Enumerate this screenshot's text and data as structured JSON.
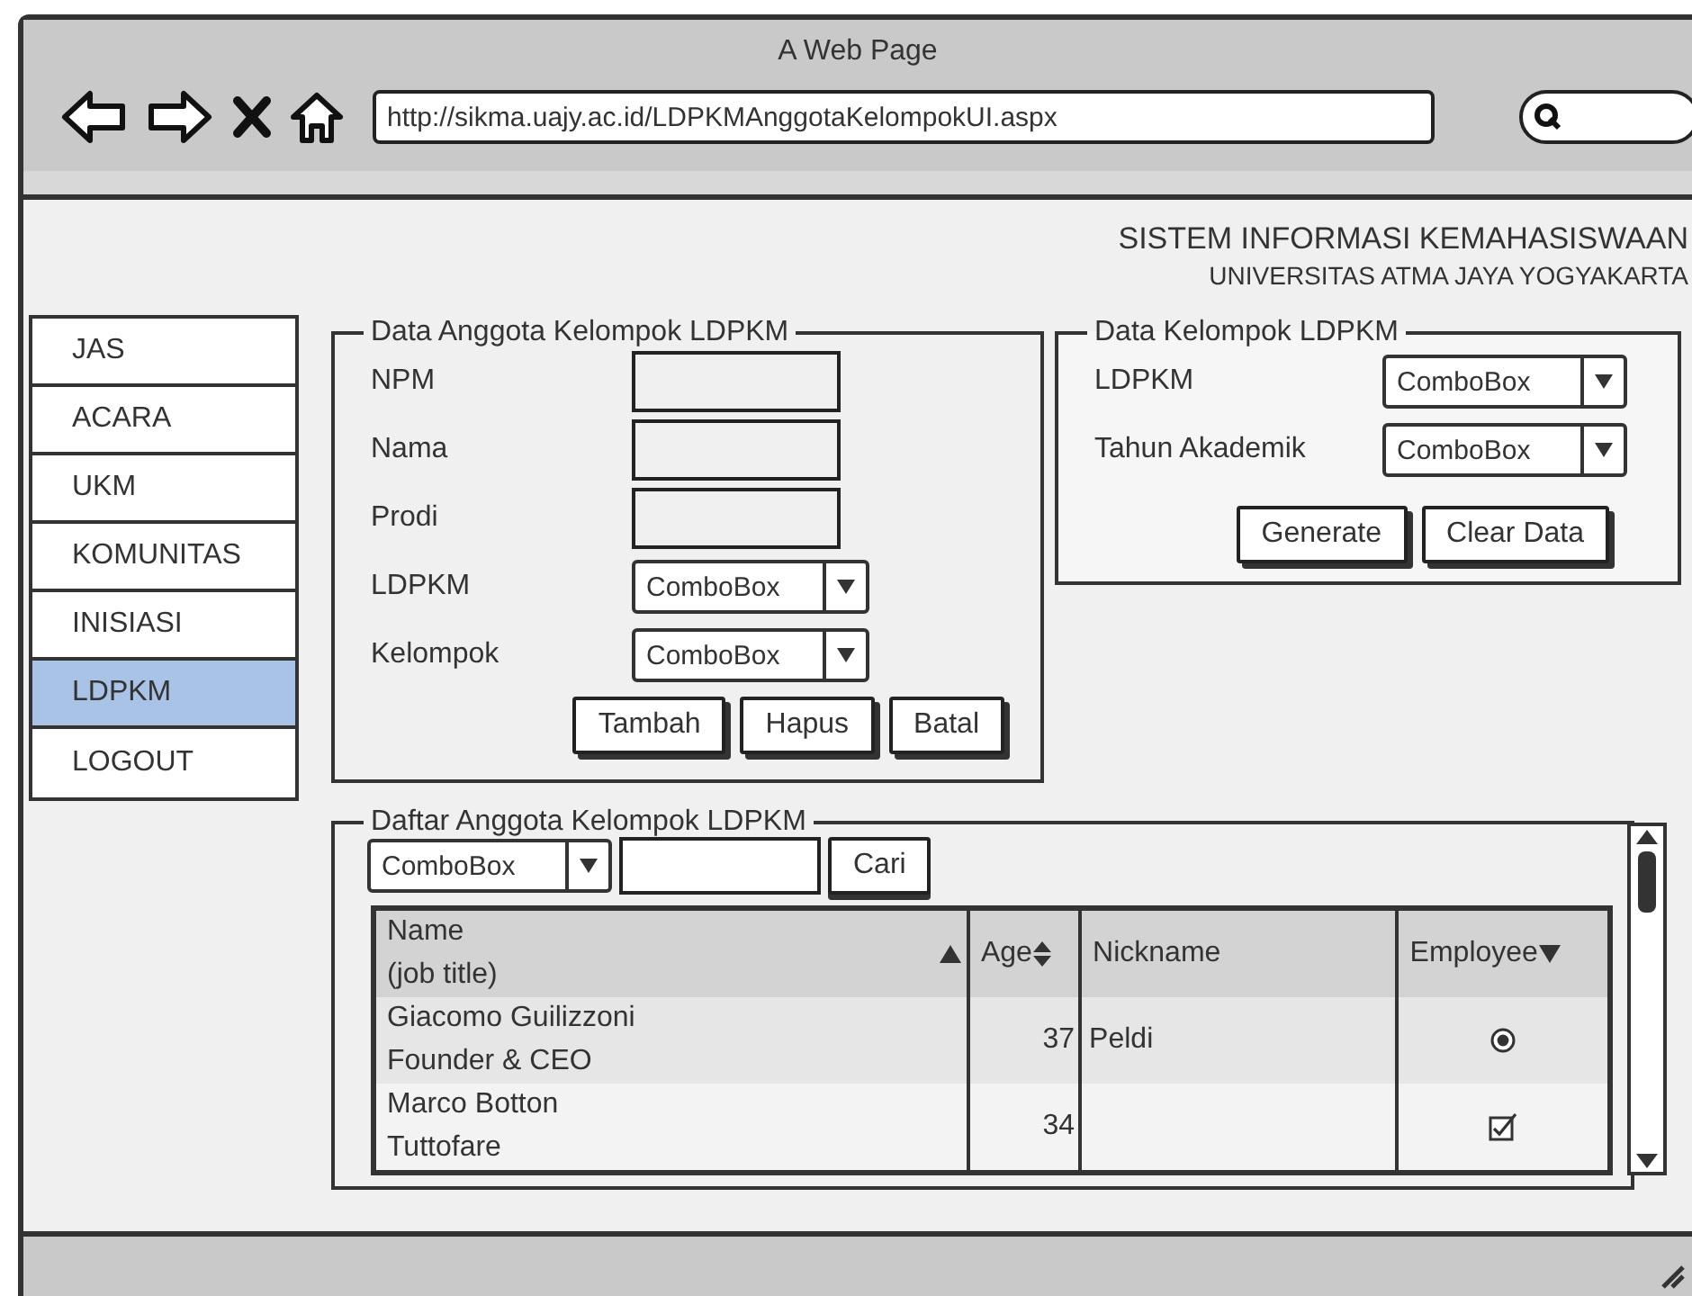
{
  "window": {
    "title": "A Web Page"
  },
  "toolbar": {
    "url": "http://sikma.uajy.ac.id/LDPKMAnggotaKelompokUI.aspx"
  },
  "header": {
    "title": "SISTEM INFORMASI KEMAHASISWAAN",
    "subtitle": "UNIVERSITAS ATMA JAYA YOGYAKARTA"
  },
  "sidebar": {
    "items": [
      {
        "label": "JAS",
        "selected": false
      },
      {
        "label": "ACARA",
        "selected": false
      },
      {
        "label": "UKM",
        "selected": false
      },
      {
        "label": "KOMUNITAS",
        "selected": false
      },
      {
        "label": "INISIASI",
        "selected": false
      },
      {
        "label": "LDPKM",
        "selected": true
      },
      {
        "label": "LOGOUT",
        "selected": false
      }
    ]
  },
  "member_form": {
    "title": "Data Anggota Kelompok LDPKM",
    "fields": [
      {
        "label": "NPM",
        "kind": "text"
      },
      {
        "label": "Nama",
        "kind": "text"
      },
      {
        "label": "Prodi",
        "kind": "text"
      },
      {
        "label": "LDPKM",
        "kind": "combo",
        "value": "ComboBox"
      },
      {
        "label": "Kelompok",
        "kind": "combo",
        "value": "ComboBox"
      }
    ],
    "buttons": [
      "Tambah",
      "Hapus",
      "Batal"
    ]
  },
  "group_form": {
    "title": "Data Kelompok LDPKM",
    "fields": [
      {
        "label": "LDPKM",
        "kind": "combo",
        "value": "ComboBox"
      },
      {
        "label": "Tahun Akademik",
        "kind": "combo",
        "value": "ComboBox"
      }
    ],
    "buttons": [
      "Generate",
      "Clear Data"
    ]
  },
  "member_list": {
    "title": "Daftar Anggota Kelompok LDPKM",
    "filter": {
      "value": "ComboBox"
    },
    "search_button": "Cari",
    "table": {
      "columns": [
        {
          "label": "Name",
          "sublabel": "(job title)",
          "sorted_ascending": true
        },
        {
          "label": "Age",
          "sortable": true
        },
        {
          "label": "Nickname"
        },
        {
          "label": "Employee",
          "sorted_descending": true
        }
      ],
      "rows": [
        {
          "name": "Giacomo Guilizzoni",
          "job_title": "Founder & CEO",
          "age": "37",
          "nickname": "Peldi",
          "employee": {
            "kind": "radio",
            "checked": true
          }
        },
        {
          "name": "Marco Botton",
          "job_title": "Tuttofare",
          "age": "34",
          "employee": {
            "kind": "checkbox",
            "checked": true
          }
        }
      ]
    }
  }
}
